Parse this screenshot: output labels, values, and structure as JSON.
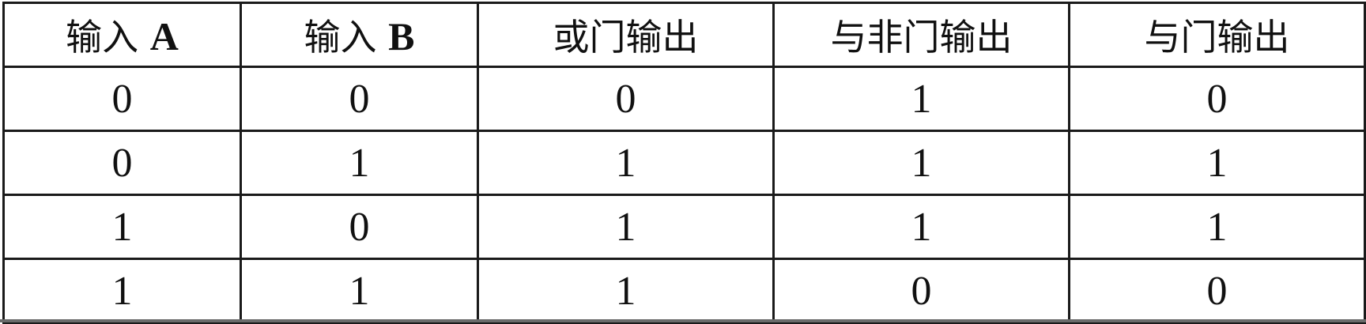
{
  "table": {
    "headers": [
      {
        "cjk": "输入 ",
        "latin": "A"
      },
      {
        "cjk": "输入 ",
        "latin": "B"
      },
      {
        "cjk": "或门输出",
        "latin": ""
      },
      {
        "cjk": "与非门输出",
        "latin": ""
      },
      {
        "cjk": "与门输出",
        "latin": ""
      }
    ],
    "rows": [
      [
        "0",
        "0",
        "0",
        "1",
        "0"
      ],
      [
        "0",
        "1",
        "1",
        "1",
        "1"
      ],
      [
        "1",
        "0",
        "1",
        "1",
        "1"
      ],
      [
        "1",
        "1",
        "1",
        "0",
        "0"
      ]
    ]
  }
}
